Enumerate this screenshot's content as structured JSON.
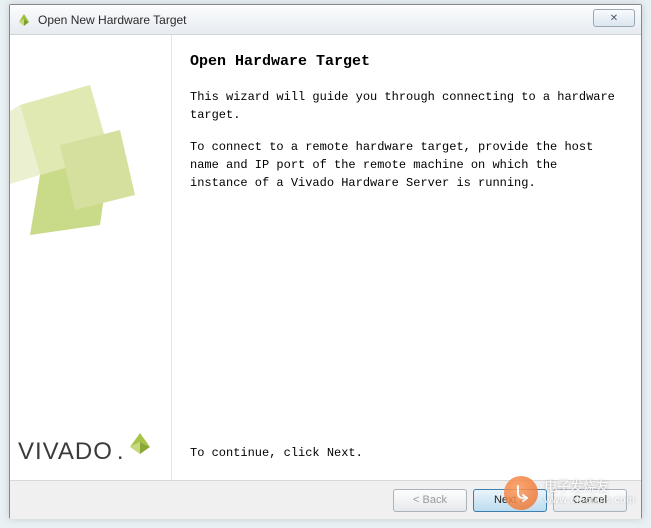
{
  "window": {
    "title": "Open New Hardware Target",
    "close_glyph": "✕"
  },
  "brand": {
    "name": "VIVADO",
    "dot": "."
  },
  "page": {
    "heading": "Open Hardware Target",
    "intro": "This wizard will guide you through connecting to a hardware target.",
    "detail": "To connect to a remote hardware target, provide the host name and IP port of the remote machine on which the instance of a Vivado Hardware Server is running.",
    "continue": "To continue, click Next."
  },
  "buttons": {
    "back": "< Back",
    "next": "Next >",
    "cancel": "Cancel"
  },
  "watermark": {
    "line1": "电子发烧友",
    "line2": "www.elecfans.com"
  }
}
